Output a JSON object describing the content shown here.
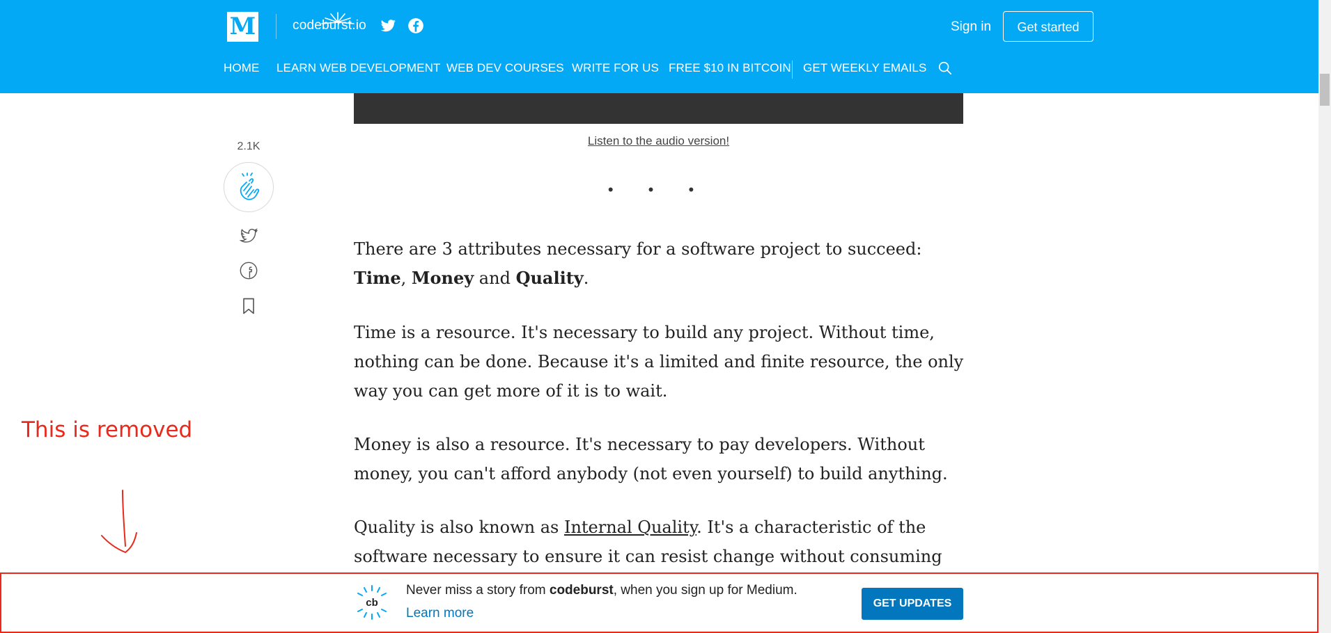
{
  "header": {
    "logo_letter": "M",
    "publication": "codeburst.io",
    "sign_in": "Sign in",
    "get_started": "Get started",
    "nav": [
      {
        "label": "HOME"
      },
      {
        "label": "LEARN WEB DEVELOPMENT"
      },
      {
        "label": "WEB DEV COURSES"
      },
      {
        "label": "WRITE FOR US"
      },
      {
        "label": "FREE $10 IN BITCOIN"
      },
      {
        "label": "GET WEEKLY EMAILS"
      }
    ]
  },
  "share_rail": {
    "clap_count": "2.1K"
  },
  "article": {
    "audio_link": "Listen to the audio version!",
    "separator": "• • •",
    "p1": {
      "a": "There are 3 attributes necessary for a software project to succeed: ",
      "time": "Time",
      "comma": ",",
      "money": "Money",
      "and": " and ",
      "quality": "Quality",
      "end": "."
    },
    "p2": "Time is a resource. It's necessary to build any project. Without time, nothing can be done. Because it's a limited and finite resource, the only way you can get more of it is to wait.",
    "p3": "Money is also a resource. It's necessary to pay developers. Without money, you can't afford anybody (not even yourself) to build anything.",
    "p4": {
      "a": "Quality is also known as ",
      "link": "Internal Quality",
      "b": ". It's a characteristic of the software necessary to ensure it can resist change without consuming more resources"
    }
  },
  "annotation": {
    "text": "This is removed",
    "color": "#e8291c"
  },
  "banner": {
    "logo_text": "cb",
    "text_a": "Never miss a story from ",
    "brand": "codeburst",
    "text_b": ", when you sign up for Medium.",
    "learn_more": "Learn more",
    "button": "GET UPDATES"
  },
  "colors": {
    "header_bg": "#03a9f4",
    "button_blue": "#0277bd"
  }
}
